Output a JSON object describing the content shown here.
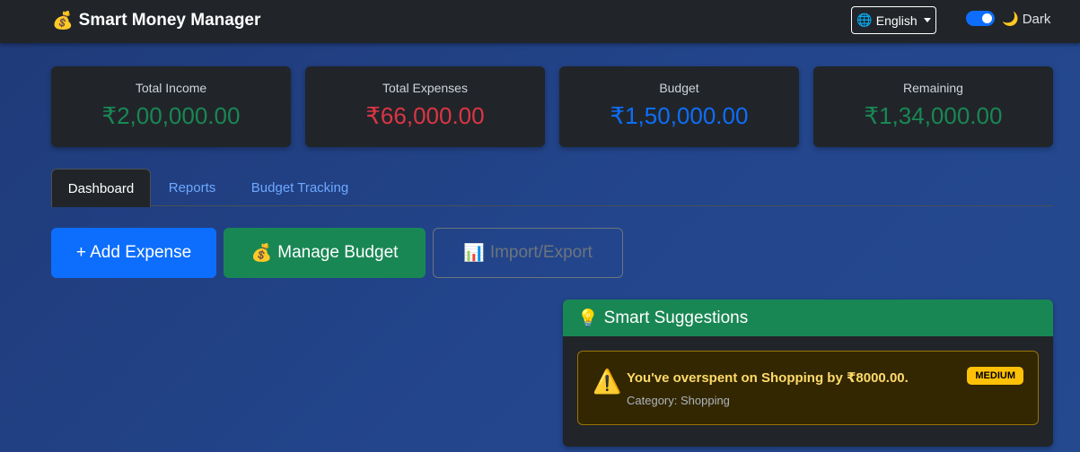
{
  "navbar": {
    "brand_icon": "💰",
    "brand": "Smart Money Manager",
    "language_icon": "🌐",
    "language": "English",
    "theme_icon": "🌙",
    "theme_label": "Dark"
  },
  "stats": [
    {
      "label": "Total Income",
      "value": "₹2,00,000.00",
      "color": "#198754"
    },
    {
      "label": "Total Expenses",
      "value": "₹66,000.00",
      "color": "#dc3545"
    },
    {
      "label": "Budget",
      "value": "₹1,50,000.00",
      "color": "#0d6efd"
    },
    {
      "label": "Remaining",
      "value": "₹1,34,000.00",
      "color": "#198754"
    }
  ],
  "tabs": [
    {
      "label": "Dashboard",
      "active": true
    },
    {
      "label": "Reports",
      "active": false
    },
    {
      "label": "Budget Tracking",
      "active": false
    }
  ],
  "actions": {
    "add_expense": "+ Add Expense",
    "manage_budget_icon": "💰",
    "manage_budget": "Manage Budget",
    "import_export_icon": "📊",
    "import_export": "Import/Export"
  },
  "suggestions": {
    "icon": "💡",
    "title": "Smart Suggestions",
    "items": [
      {
        "icon": "⚠️",
        "message": "You've overspent on Shopping by ₹8000.00.",
        "category": "Category: Shopping",
        "priority": "MEDIUM"
      }
    ]
  }
}
